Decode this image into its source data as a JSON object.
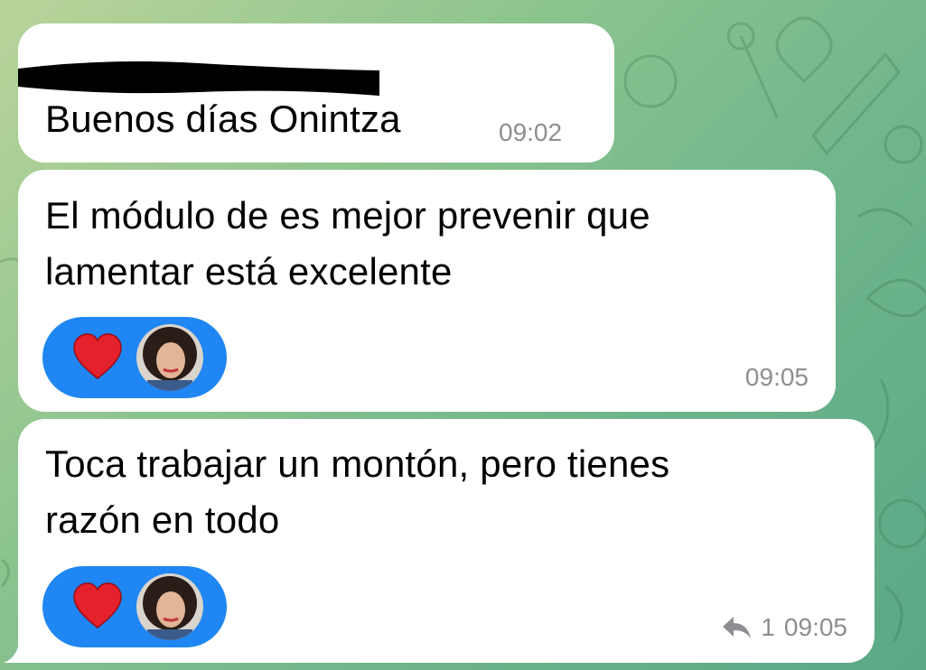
{
  "messages": [
    {
      "text": "Buenos días Onintza",
      "time": "09:02",
      "sender_redacted": true
    },
    {
      "lines": [
        "El módulo de es mejor prevenir que",
        "lamentar está excelente"
      ],
      "time": "09:05",
      "reaction": {
        "emoji": "heart-icon",
        "by": "avatar"
      }
    },
    {
      "lines": [
        "Toca trabajar un montón, pero tienes",
        "razón en todo"
      ],
      "time": "09:05",
      "reply_count": "1",
      "reaction": {
        "emoji": "heart-icon",
        "by": "avatar"
      }
    }
  ],
  "colors": {
    "bubble": "#ffffff",
    "reaction_pill": "#1f86f3",
    "heart": "#e5212b",
    "timestamp": "#8e8e93",
    "background": "#7fbf8c"
  }
}
